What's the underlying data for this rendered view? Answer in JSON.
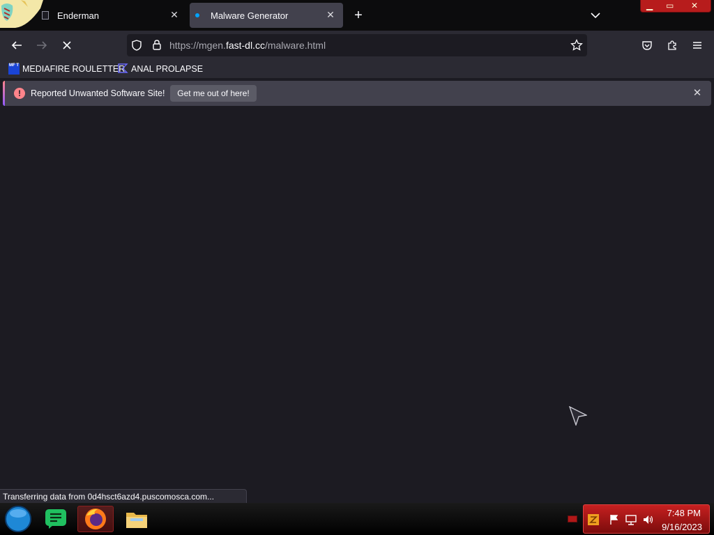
{
  "tabs": [
    {
      "label": "Enderman",
      "close_glyph": "✕",
      "active": false
    },
    {
      "label": "Malware Generator",
      "close_glyph": "✕",
      "active": true
    }
  ],
  "new_tab_glyph": "+",
  "window_controls": {
    "minimize": "▁",
    "maximize": "▭",
    "close": "✕"
  },
  "url": {
    "prefix": "https://mgen.",
    "domain": "fast-dl.cc",
    "path": "/malware.html"
  },
  "bookmarks": [
    {
      "label": "MEDIAFIRE ROULETTER",
      "icon_text": "MF T"
    },
    {
      "label": "ANAL PROLAPSE"
    }
  ],
  "notification": {
    "message": "Reported Unwanted Software Site!",
    "button": "Get me out of here!",
    "warn_glyph": "!",
    "close_glyph": "✕"
  },
  "status_text": "Transferring data from 0d4hsct6azd4.pusco​mosca.com...",
  "clock": {
    "time": "7:48 PM",
    "date": "9/16/2023"
  },
  "colors": {
    "accent": "#ff848b",
    "tray": "#c62020",
    "active_tab": "#42414d"
  }
}
